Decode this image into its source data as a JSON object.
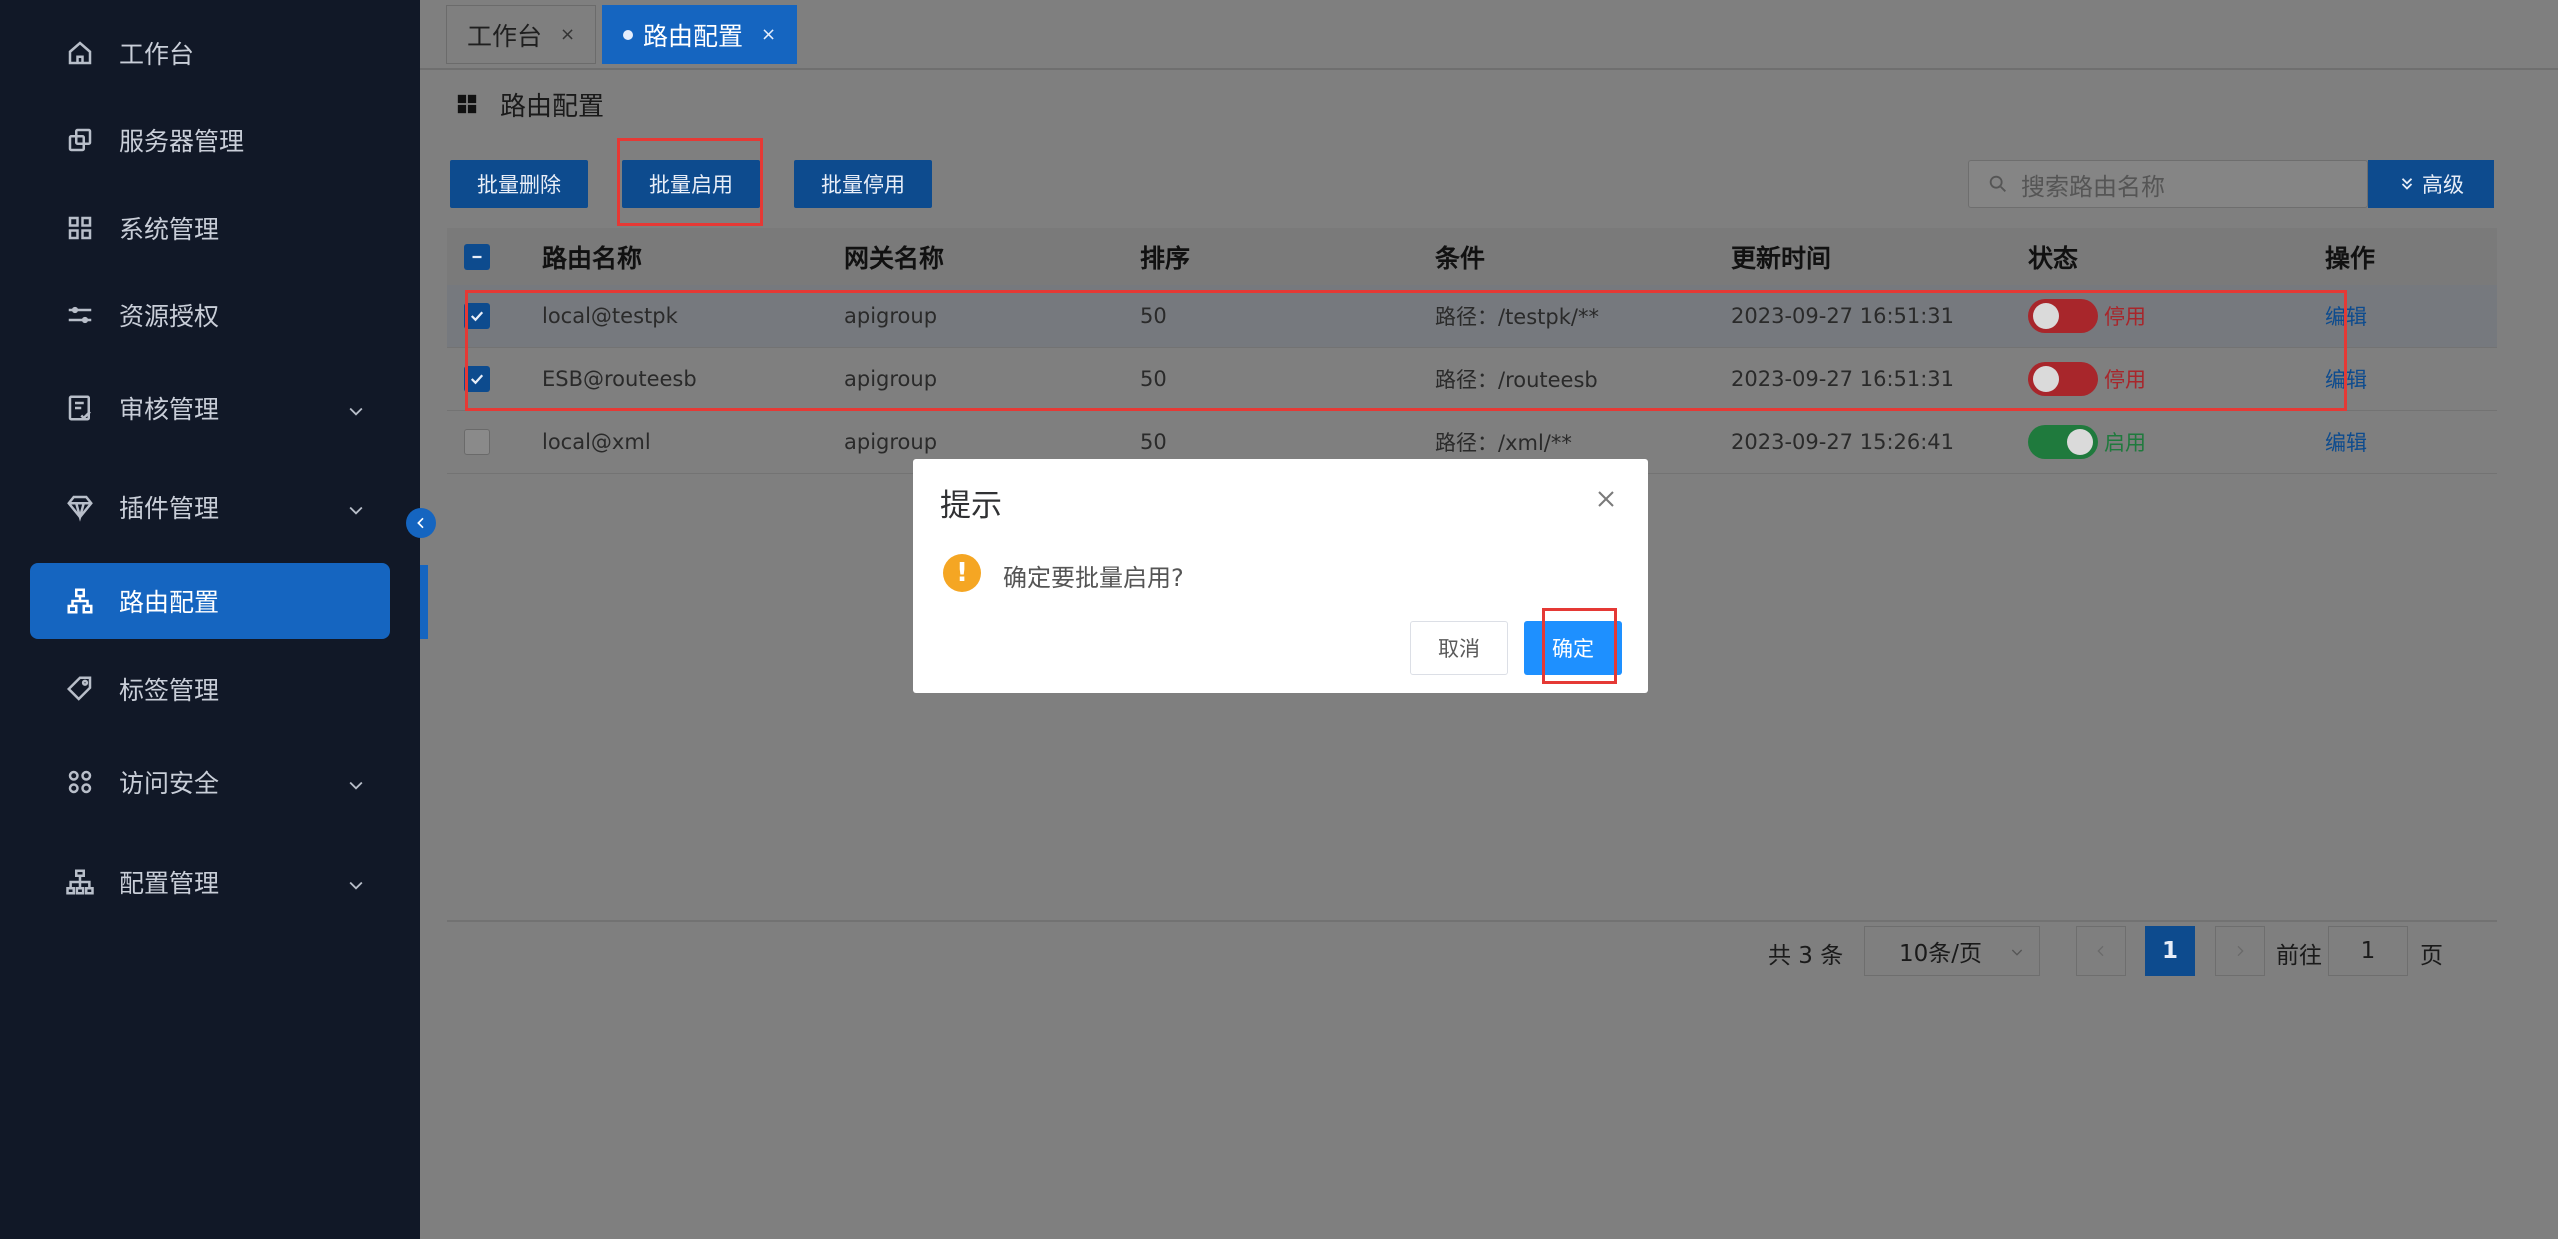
{
  "sidebar": {
    "items": [
      {
        "label": "工作台",
        "icon": "home-icon"
      },
      {
        "label": "服务器管理",
        "icon": "server-icon"
      },
      {
        "label": "系统管理",
        "icon": "grid-icon"
      },
      {
        "label": "资源授权",
        "icon": "sliders-icon"
      },
      {
        "label": "审核管理",
        "icon": "audit-icon"
      },
      {
        "label": "插件管理",
        "icon": "diamond-icon"
      },
      {
        "label": "路由配置",
        "icon": "sitemap-icon"
      },
      {
        "label": "标签管理",
        "icon": "tag-icon"
      },
      {
        "label": "访问安全",
        "icon": "apps-icon"
      },
      {
        "label": "配置管理",
        "icon": "hierarchy-icon"
      }
    ],
    "active": "路由配置"
  },
  "tabs": [
    {
      "label": "工作台",
      "close": "×"
    },
    {
      "label": "路由配置",
      "close": "×"
    }
  ],
  "page": {
    "title": "路由配置"
  },
  "toolbar": {
    "batch_delete": "批量删除",
    "batch_enable": "批量启用",
    "batch_disable": "批量停用",
    "search_placeholder": "搜索路由名称",
    "advanced": "高级"
  },
  "table": {
    "headers": [
      "路由名称",
      "网关名称",
      "排序",
      "条件",
      "更新时间",
      "状态",
      "操作"
    ],
    "rows": [
      {
        "name": "local@testpk",
        "gateway": "apigroup",
        "order": "50",
        "condition": "路径：/testpk/**",
        "updated": "2023-09-27 16:51:31",
        "status": "停用",
        "enabled": false,
        "selected": true,
        "action": "编辑"
      },
      {
        "name": "ESB@routeesb",
        "gateway": "apigroup",
        "order": "50",
        "condition": "路径：/routeesb",
        "updated": "2023-09-27 16:51:31",
        "status": "停用",
        "enabled": false,
        "selected": true,
        "action": "编辑"
      },
      {
        "name": "local@xml",
        "gateway": "apigroup",
        "order": "50",
        "condition": "路径：/xml/**",
        "updated": "2023-09-27 15:26:41",
        "status": "启用",
        "enabled": true,
        "selected": false,
        "action": "编辑"
      }
    ]
  },
  "pagination": {
    "total": "共 3 条",
    "page_size": "10条/页",
    "current": "1",
    "goto_label": "前往",
    "goto_value": "1",
    "page_suffix": "页"
  },
  "dialog": {
    "title": "提示",
    "message": "确定要批量启用?",
    "cancel": "取消",
    "confirm": "确定"
  },
  "colors": {
    "accent": "#1565c0",
    "danger": "#e53935",
    "success": "#1f7a3d",
    "warning": "#f5a623",
    "sidebar_bg": "#111827"
  }
}
